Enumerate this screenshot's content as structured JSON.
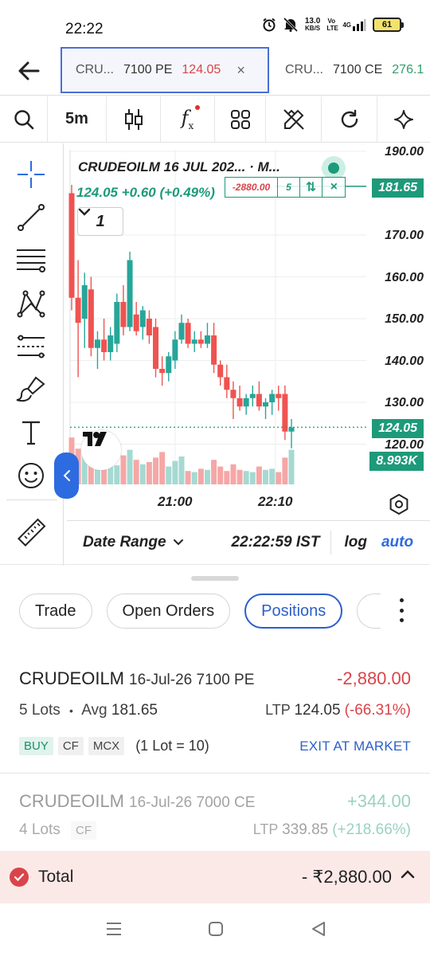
{
  "status_bar": {
    "time": "22:22",
    "net_speed_value": "13.0",
    "net_speed_unit": "KB/S",
    "volte": "Vo LTE",
    "network": "4G",
    "battery": "61"
  },
  "tabs": [
    {
      "symbol": "CRU...",
      "strike": "7100 PE",
      "price": "124.05",
      "close": "×",
      "active": true
    },
    {
      "symbol": "CRU...",
      "strike": "7100 CE",
      "price": "276.1",
      "active": false
    }
  ],
  "toolbar": {
    "interval": "5m",
    "fx_label": "f",
    "fx_sub": "x"
  },
  "chart": {
    "legend_title": "CRUDEOILM 16 JUL 202...  · M...",
    "legend_change": "124.05  +0.60 (+0.49%)",
    "collapse_count": "1",
    "order_line": {
      "pnl": "-2880.00",
      "qty": "5",
      "reverse": "⇅",
      "close": "×"
    },
    "tags": {
      "entry": "181.65",
      "last": "124.05",
      "volume": "8.993K"
    },
    "axis_labels": [
      "190.00",
      "170.00",
      "160.00",
      "150.00",
      "140.00",
      "130.00",
      "120.00"
    ],
    "time_labels": [
      "21:00",
      "22:10"
    ],
    "tv_logo": "TV"
  },
  "chart_data": {
    "type": "candlestick",
    "y_ticks": [
      120,
      130,
      140,
      150,
      160,
      170,
      190
    ],
    "ylim": [
      116,
      192
    ],
    "price_lines": {
      "entry": 181.65,
      "last": 124.05
    },
    "x_tick_labels": [
      "21:00",
      "22:10"
    ],
    "candles": [
      {
        "o": 180,
        "h": 182,
        "l": 152,
        "c": 155
      },
      {
        "o": 155,
        "h": 164,
        "l": 136,
        "c": 149
      },
      {
        "o": 150,
        "h": 161,
        "l": 143,
        "c": 158
      },
      {
        "o": 157,
        "h": 160,
        "l": 141,
        "c": 143
      },
      {
        "o": 143,
        "h": 147,
        "l": 138,
        "c": 145
      },
      {
        "o": 145,
        "h": 150,
        "l": 140,
        "c": 142
      },
      {
        "o": 142,
        "h": 148,
        "l": 140,
        "c": 146
      },
      {
        "o": 144,
        "h": 156,
        "l": 142,
        "c": 154
      },
      {
        "o": 154,
        "h": 158,
        "l": 146,
        "c": 148
      },
      {
        "o": 148,
        "h": 166,
        "l": 147,
        "c": 164
      },
      {
        "o": 151,
        "h": 154,
        "l": 146,
        "c": 147
      },
      {
        "o": 148,
        "h": 153,
        "l": 145,
        "c": 152
      },
      {
        "o": 150,
        "h": 152,
        "l": 144,
        "c": 146
      },
      {
        "o": 148,
        "h": 150,
        "l": 136,
        "c": 138
      },
      {
        "o": 138,
        "h": 141,
        "l": 134,
        "c": 137
      },
      {
        "o": 137,
        "h": 142,
        "l": 135,
        "c": 141
      },
      {
        "o": 140,
        "h": 147,
        "l": 138,
        "c": 145
      },
      {
        "o": 145,
        "h": 151,
        "l": 144,
        "c": 149
      },
      {
        "o": 149,
        "h": 150,
        "l": 143,
        "c": 144
      },
      {
        "o": 144,
        "h": 147,
        "l": 142,
        "c": 145
      },
      {
        "o": 145,
        "h": 147,
        "l": 143,
        "c": 144
      },
      {
        "o": 144,
        "h": 149,
        "l": 143,
        "c": 146
      },
      {
        "o": 146,
        "h": 149,
        "l": 137,
        "c": 139
      },
      {
        "o": 139,
        "h": 140,
        "l": 134,
        "c": 136
      },
      {
        "o": 136,
        "h": 139,
        "l": 131,
        "c": 133
      },
      {
        "o": 133,
        "h": 135,
        "l": 126,
        "c": 131
      },
      {
        "o": 131,
        "h": 134,
        "l": 128,
        "c": 129
      },
      {
        "o": 129,
        "h": 132,
        "l": 127,
        "c": 131
      },
      {
        "o": 131,
        "h": 134,
        "l": 129,
        "c": 132
      },
      {
        "o": 132,
        "h": 135,
        "l": 128,
        "c": 129
      },
      {
        "o": 129,
        "h": 131,
        "l": 126,
        "c": 130
      },
      {
        "o": 130,
        "h": 133,
        "l": 127,
        "c": 132
      },
      {
        "o": 132,
        "h": 134,
        "l": 128,
        "c": 131
      },
      {
        "o": 132,
        "h": 134,
        "l": 121,
        "c": 123
      },
      {
        "o": 123,
        "h": 126,
        "l": 119,
        "c": 124
      }
    ]
  },
  "date_bar": {
    "date_range": "Date Range",
    "clock": "22:22:59 IST",
    "log": "log",
    "auto": "auto"
  },
  "sheet": {
    "pills": [
      "Trade",
      "Open Orders",
      "Positions"
    ],
    "active_pill": "Positions",
    "positions": [
      {
        "symbol": "CRUDEOILM",
        "contract": "16-Jul-26 7100 PE",
        "pnl": "-2,880.00",
        "lots": "5 Lots",
        "bullet": "•",
        "avg_label": "Avg",
        "avg": "181.65",
        "ltp_label": "LTP",
        "ltp": "124.05",
        "ltp_change": "(-66.31%)",
        "tags": [
          "BUY",
          "CF",
          "MCX"
        ],
        "lot_info": "(1 Lot = 10)",
        "action": "EXIT AT MARKET"
      },
      {
        "symbol": "CRUDEOILM",
        "contract": "16-Jul-26 7000 CE",
        "pnl": "+344.00",
        "lots": "4 Lots",
        "tag": "CF",
        "ltp_label": "LTP",
        "ltp": "339.85",
        "ltp_change": "(+218.66%)"
      }
    ],
    "total_label": "Total",
    "total_value": "- ₹2,880.00"
  },
  "colors": {
    "up": "#1d9a7a",
    "down": "#ef5350",
    "accent": "#2d6be0",
    "negative": "#d9444a"
  }
}
